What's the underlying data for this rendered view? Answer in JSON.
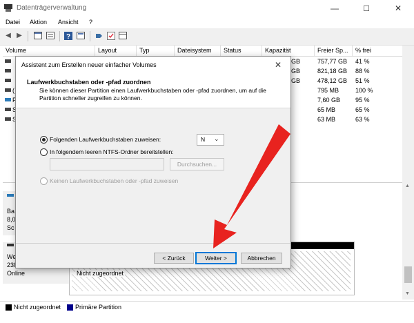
{
  "window": {
    "title": "Datenträgerverwaltung",
    "minimize": "—",
    "maximize": "☐",
    "close": "✕"
  },
  "menu": [
    "Datei",
    "Aktion",
    "Ansicht",
    "?"
  ],
  "volume_list": {
    "headers": [
      "Volume",
      "Layout",
      "Typ",
      "Dateisystem",
      "Status",
      "Kapazität",
      "Freier Sp...",
      "% frei"
    ],
    "rows": [
      {
        "capacity": "GB",
        "free": "757,77 GB",
        "pct": "41 %"
      },
      {
        "capacity": "GB",
        "free": "821,18 GB",
        "pct": "88 %"
      },
      {
        "capacity": "GB",
        "free": "478,12 GB",
        "pct": "51 %"
      },
      {
        "capacity": "",
        "free": "795 MB",
        "pct": "100 %"
      },
      {
        "capacity": "",
        "free": "7,60 GB",
        "pct": "95 %"
      },
      {
        "capacity": "",
        "free": "65 MB",
        "pct": "65 %"
      },
      {
        "capacity": "",
        "free": "63 MB",
        "pct": "63 %"
      }
    ],
    "volume_letters": [
      "",
      "",
      "",
      "(",
      "F",
      "S",
      "S"
    ]
  },
  "disk_pane": {
    "disk_label_lines": [
      "Ba",
      "8,0",
      "Sc"
    ],
    "disk2_label_lines": [
      "We",
      "238",
      "Online"
    ],
    "unallocated_label": "Nicht zugeordnet"
  },
  "legend": [
    {
      "label": "Nicht zugeordnet",
      "color": "#000000"
    },
    {
      "label": "Primäre Partition",
      "color": "#00008b"
    }
  ],
  "dialog": {
    "title": "Assistent zum Erstellen neuer einfacher Volumes",
    "close": "✕",
    "heading": "Laufwerkbuchstaben oder -pfad zuordnen",
    "description": "Sie können dieser Partition einen Laufwerkbuchstaben oder -pfad zuordnen, um auf die Partition schneller zugreifen zu können.",
    "option_letter": "Folgenden Laufwerkbuchstaben zuweisen:",
    "drive_letter": "N",
    "option_folder": "In folgendem leeren NTFS-Ordner bereitstellen:",
    "folder_value": "",
    "browse": "Durchsuchen...",
    "option_none": "Keinen Laufwerkbuchstaben oder -pfad zuweisen",
    "back": "< Zurück",
    "next": "Weiter >",
    "cancel": "Abbrechen"
  },
  "colors": {
    "annotation_arrow": "#e8231f",
    "focus": "#0078d7"
  }
}
